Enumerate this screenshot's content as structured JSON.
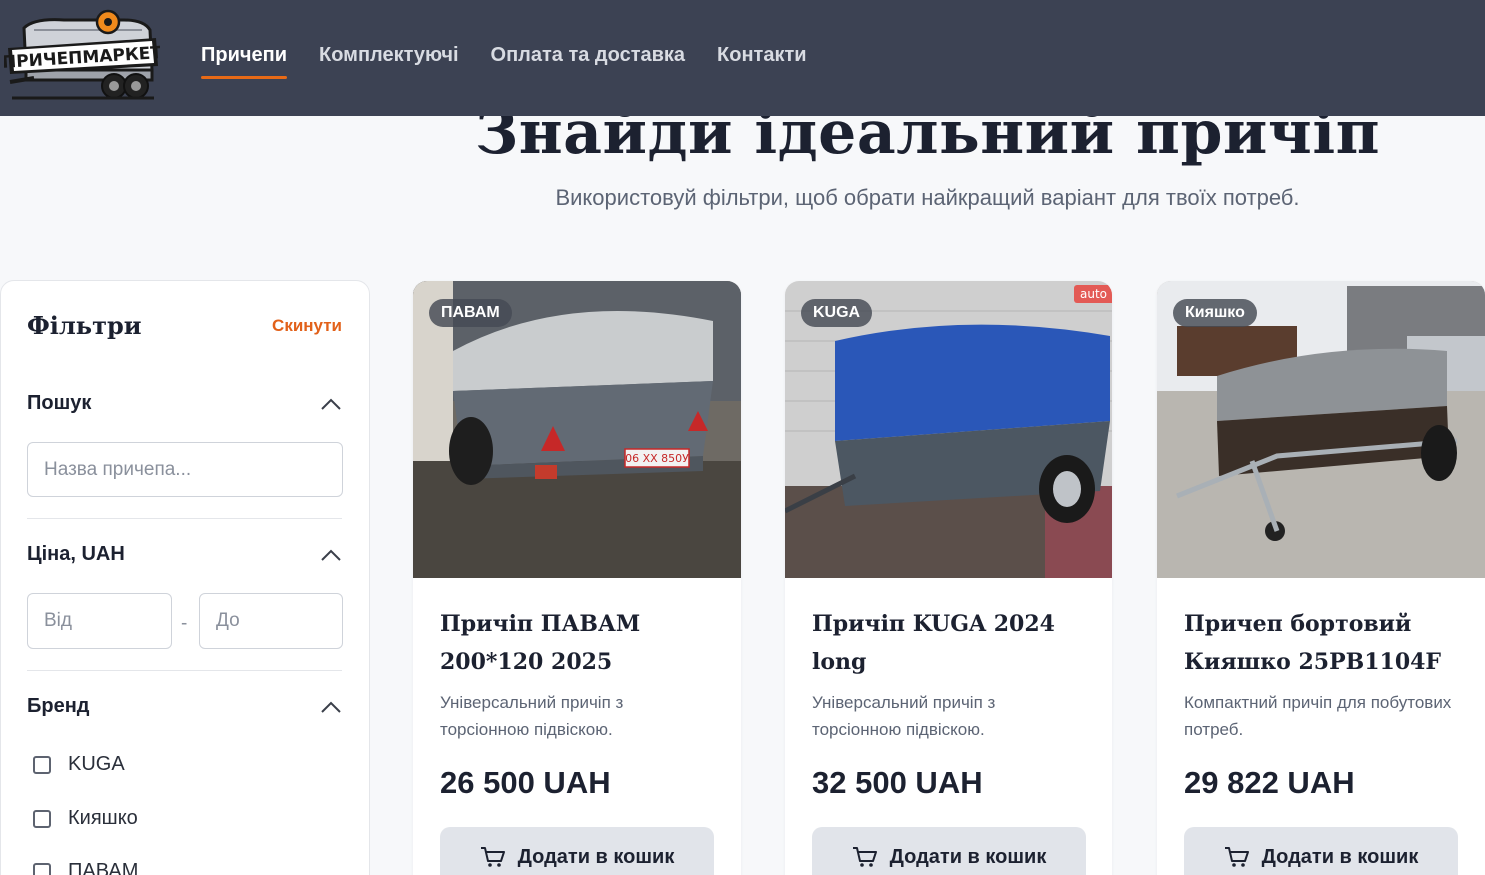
{
  "header": {
    "logo_text": "ПРИЧЕПМАРКЕТ",
    "nav": [
      {
        "label": "Причепи",
        "active": true
      },
      {
        "label": "Комплектуючі",
        "active": false
      },
      {
        "label": "Оплата та доставка",
        "active": false
      },
      {
        "label": "Контакти",
        "active": false
      }
    ]
  },
  "hero": {
    "title": "Знайди ідеальний причіп",
    "subtitle": "Використовуй фільтри, щоб обрати найкращий варіант для твоїх потреб."
  },
  "filters": {
    "title": "Фільтри",
    "reset_label": "Скинути",
    "search": {
      "title": "Пошук",
      "placeholder": "Назва причепа...",
      "value": ""
    },
    "price": {
      "title": "Ціна, UAH",
      "from_placeholder": "Від",
      "to_placeholder": "До",
      "separator": "-"
    },
    "brand": {
      "title": "Бренд",
      "options": [
        {
          "label": "KUGA",
          "checked": false
        },
        {
          "label": "Кияшко",
          "checked": false
        },
        {
          "label": "ПАВАМ",
          "checked": false
        }
      ]
    }
  },
  "products": [
    {
      "badge": "ПАВАМ",
      "title": "Причіп ПАВАМ 200*120 2025",
      "description": "Універсальний причіп з торсіонною підвіскою.",
      "price": "26 500 UAH",
      "button_label": "Додати в кошик",
      "image_icon": "trailer-photo-grey-cover",
      "plate": "06 XX 850У"
    },
    {
      "badge": "KUGA",
      "corner_tag": "auto",
      "title": "Причіп KUGA 2024 long",
      "description": "Універсальний причіп з торсіонною підвіскою.",
      "price": "32 500 UAH",
      "button_label": "Додати в кошик",
      "image_icon": "trailer-photo-blue-cover"
    },
    {
      "badge": "Кияшко",
      "title": "Причеп бортовий Кияшко 25РВ1104F",
      "description": "Компактний причіп для побутових потреб.",
      "price": "29 822 UAH",
      "button_label": "Додати в кошик",
      "image_icon": "trailer-photo-lot"
    }
  ],
  "colors": {
    "header_bg": "#3c4253",
    "accent": "#e86a16",
    "page_bg": "#f7f8fa",
    "button_bg": "#e1e4ea"
  }
}
